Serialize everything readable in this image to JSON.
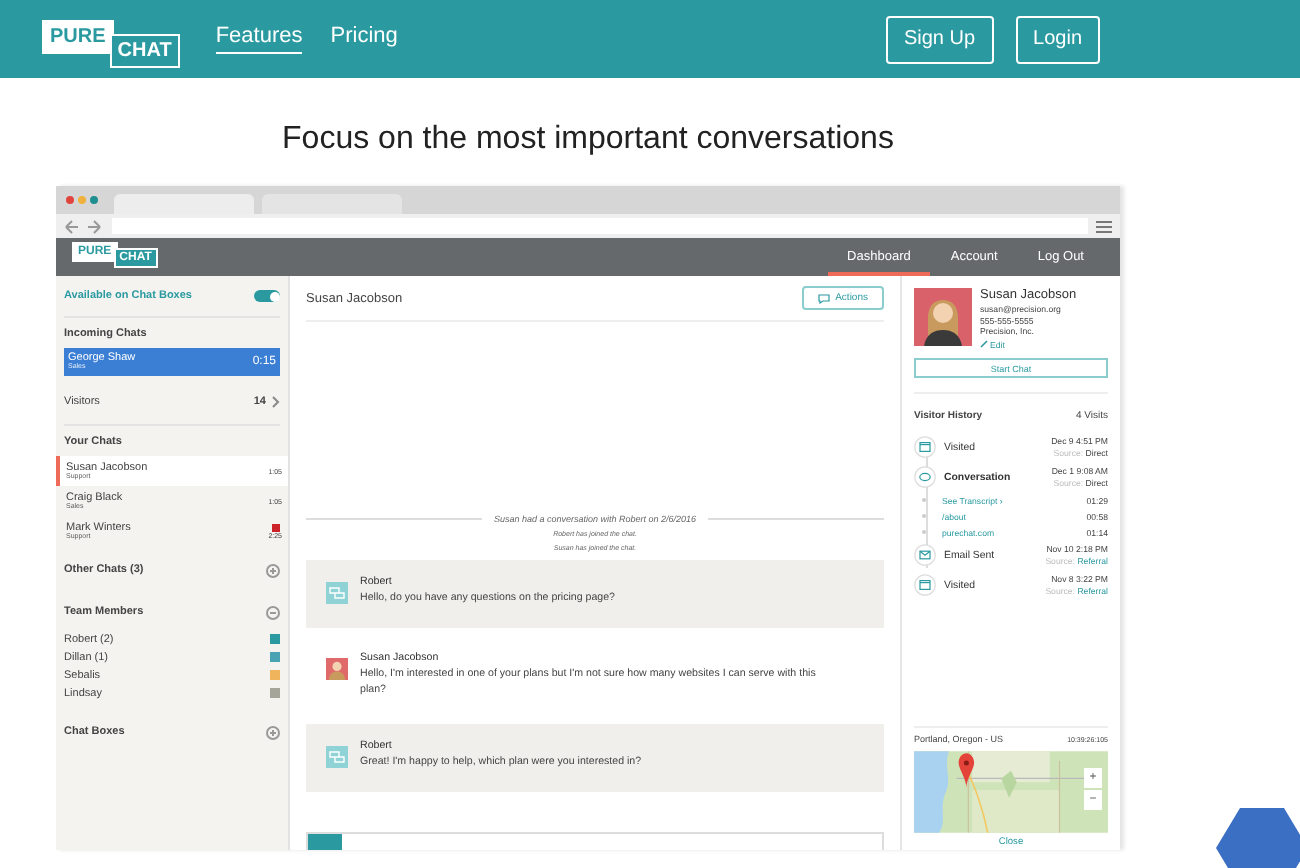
{
  "site_nav": {
    "logo": {
      "top": "PURE",
      "bottom": "CHAT"
    },
    "links": [
      {
        "label": "Features",
        "selected": true
      },
      {
        "label": "Pricing",
        "selected": false
      }
    ],
    "buttons": [
      "Sign Up",
      "Login"
    ]
  },
  "heading": "Focus on the most important conversations",
  "app_nav": {
    "logo": {
      "top": "PURE",
      "bottom": "CHAT"
    },
    "tabs": [
      {
        "label": "Dashboard",
        "selected": true
      },
      {
        "label": "Account",
        "selected": false
      },
      {
        "label": "Log Out",
        "selected": false
      }
    ]
  },
  "sidebar": {
    "availability": {
      "label": "Available on Chat Boxes",
      "on": true
    },
    "incoming": {
      "title": "Incoming Chats",
      "chats": [
        {
          "name": "George Shaw",
          "dept": "Sales",
          "time": "0:15",
          "selected": true
        }
      ]
    },
    "visitors": {
      "label": "Visitors",
      "count": "14"
    },
    "your_chats": {
      "title": "Your Chats",
      "chats": [
        {
          "name": "Susan Jacobson",
          "dept": "Support",
          "time": "1:05",
          "selected": true,
          "unread": false
        },
        {
          "name": "Craig Black",
          "dept": "Sales",
          "time": "1:05",
          "selected": false,
          "unread": false
        },
        {
          "name": "Mark Winters",
          "dept": "Support",
          "time": "2:25",
          "selected": false,
          "unread": true
        }
      ]
    },
    "other_chats": {
      "title": "Other Chats (3)",
      "expanded": false
    },
    "team": {
      "title": "Team Members",
      "expanded": true,
      "members": [
        {
          "name": "Robert (2)",
          "color": "#2a9aa0"
        },
        {
          "name": "Dillan (1)",
          "color": "#4aa3b3"
        },
        {
          "name": "Sebalis",
          "color": "#f0b45c"
        },
        {
          "name": "Lindsay",
          "color": "#a5a59a"
        }
      ]
    },
    "chat_boxes": {
      "title": "Chat Boxes",
      "expanded": false
    }
  },
  "chat": {
    "visitor": "Susan Jacobson",
    "actions": "Actions",
    "history_note": "Susan had a conversation with Robert on 2/6/2016",
    "events": [
      "Robert has joined the chat.",
      "Susan has joined the chat."
    ],
    "messages": [
      {
        "kind": "agent",
        "author": "Robert",
        "text": "Hello, do you have any questions on the pricing page?"
      },
      {
        "kind": "visitor",
        "author": "Susan Jacobson",
        "text": "Hello, I'm interested in one of your plans but I'm not sure how many websites I can serve with this plan?"
      },
      {
        "kind": "agent",
        "author": "Robert",
        "text": "Great! I'm happy to help, which plan were you interested in?"
      }
    ]
  },
  "profile": {
    "name": "Susan Jacobson",
    "email": "susan@precision.org",
    "phone": "555-555-5555",
    "company": "Precision, Inc.",
    "edit": "Edit",
    "start_chat": "Start Chat"
  },
  "history": {
    "title": "Visitor History",
    "count": "4 Visits",
    "items": [
      {
        "kind": "visited",
        "label": "Visited",
        "date": "Dec 9 4:51 PM",
        "source_label": "Source:",
        "source": "Direct"
      },
      {
        "kind": "conversation",
        "label": "Conversation",
        "date": "Dec 1 9:08 AM",
        "source_label": "Source:",
        "source": "Direct",
        "pages": [
          {
            "label": "See Transcript ›",
            "time": "01:29"
          },
          {
            "label": "/about",
            "time": "00:58"
          },
          {
            "label": "purechat.com",
            "time": "01:14"
          }
        ]
      },
      {
        "kind": "email",
        "label": "Email Sent",
        "date": "Nov 10 2:18 PM",
        "source_label": "Source:",
        "source": "Referral"
      },
      {
        "kind": "visited",
        "label": "Visited",
        "date": "Nov 8 3:22 PM",
        "source_label": "Source:",
        "source": "Referral"
      }
    ]
  },
  "location": {
    "place": "Portland, Oregon - US",
    "time": "10:39:26:105",
    "zoom_in": "+",
    "zoom_out": "−",
    "close": "Close"
  }
}
